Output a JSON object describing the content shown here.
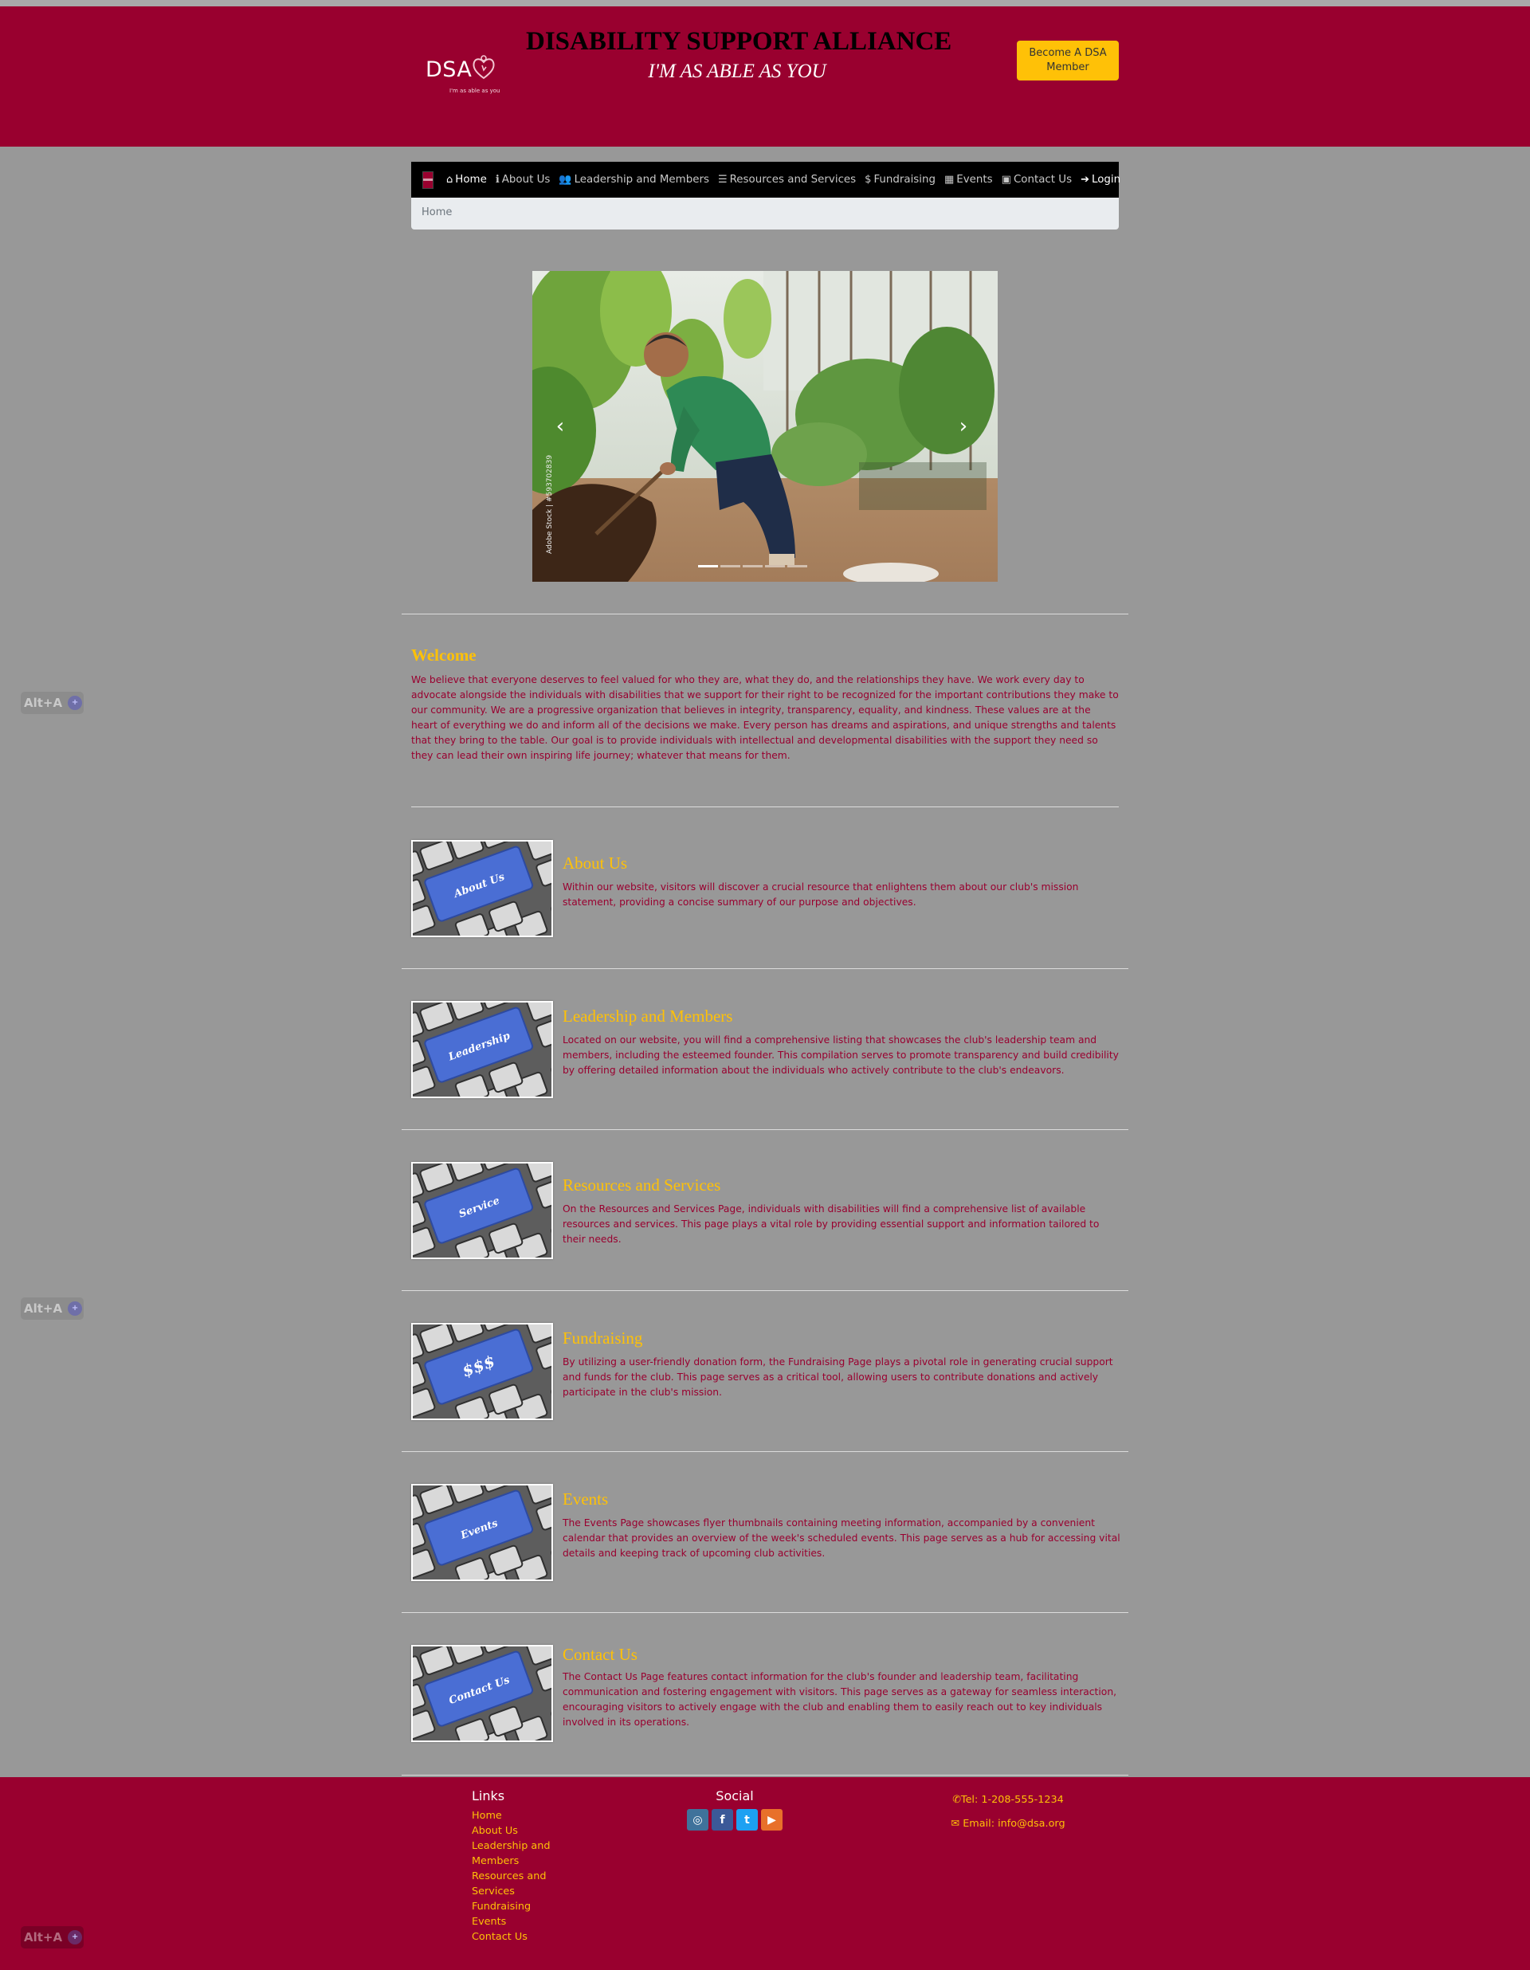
{
  "header": {
    "logo_text": "DSA",
    "logo_tagline": "I'm as able as you",
    "title": "DISABILITY SUPPORT ALLIANCE",
    "tagline": "I'M AS ABLE AS YOU",
    "member_button": "Become A DSA Member",
    "background_color": "#99002f",
    "accent_color": "#ffc107"
  },
  "nav": {
    "items": [
      {
        "label": "Home",
        "icon": "home-icon",
        "active": true
      },
      {
        "label": "About Us",
        "icon": "info-icon"
      },
      {
        "label": "Leadership and Members",
        "icon": "users-icon"
      },
      {
        "label": "Resources and Services",
        "icon": "list-icon"
      },
      {
        "label": "Fundraising",
        "icon": "dollar-icon"
      },
      {
        "label": "Events",
        "icon": "calendar-icon"
      },
      {
        "label": "Contact Us",
        "icon": "address-card-icon"
      },
      {
        "label": "Login",
        "icon": "sign-in-icon"
      }
    ],
    "breadcrumb": "Home"
  },
  "carousel": {
    "credit": "Adobe Stock | #593702839",
    "slide_count": 5,
    "active_slide": 1
  },
  "welcome": {
    "heading": "Welcome",
    "body": "We believe that everyone deserves to feel valued for who they are, what they do, and the relationships they have. We work every day to advocate alongside the individuals with disabilities that we support for their right to be recognized for the important contributions they make to our community. We are a progressive organization that believes in integrity, transparency, equality, and kindness. These values are at the heart of everything we do and inform all of the decisions we make. Every person has dreams and aspirations, and unique strengths and talents that they bring to the table. Our goal is to provide individuals with intellectual and developmental disabilities with the support they need so they can lead their own inspiring life journey; whatever that means for them."
  },
  "features": [
    {
      "title": "About Us",
      "key_label": "About Us",
      "text": "Within our website, visitors will discover a crucial resource that enlightens them about our club's mission statement, providing a concise summary of our purpose and objectives."
    },
    {
      "title": "Leadership and Members",
      "key_label": "Leadership",
      "text": "Located on our website, you will find a comprehensive listing that showcases the club's leadership team and members, including the esteemed founder. This compilation serves to promote transparency and build credibility by offering detailed information about the individuals who actively contribute to the club's endeavors."
    },
    {
      "title": "Resources and Services",
      "key_label": "Service",
      "text": "On the Resources and Services Page, individuals with disabilities will find a comprehensive list of available resources and services. This page plays a vital role by providing essential support and information tailored to their needs."
    },
    {
      "title": "Fundraising",
      "key_label": "$$$",
      "text": "By utilizing a user-friendly donation form, the Fundraising Page plays a pivotal role in generating crucial support and funds for the club. This page serves as a critical tool, allowing users to contribute donations and actively participate in the club's mission."
    },
    {
      "title": "Events",
      "key_label": "Events",
      "text": "The Events Page showcases flyer thumbnails containing meeting information, accompanied by a convenient calendar that provides an overview of the week's scheduled events. This page serves as a hub for accessing vital details and keeping track of upcoming club activities."
    },
    {
      "title": "Contact Us",
      "key_label": "Contact Us",
      "text": "The Contact Us Page features contact information for the club's founder and leadership team, facilitating communication and fostering engagement with visitors. This page serves as a gateway for seamless interaction, encouraging visitors to actively engage with the club and enabling them to easily reach out to key individuals involved in its operations."
    }
  ],
  "footer": {
    "links_heading": "Links",
    "links": [
      "Home",
      "About Us",
      "Leadership and Members",
      "Resources and Services",
      "Fundraising",
      "Events",
      "Contact Us"
    ],
    "social_heading": "Social",
    "social": [
      {
        "icon": "instagram-icon",
        "color": "#3f729b"
      },
      {
        "icon": "facebook-icon",
        "color": "#3b5998"
      },
      {
        "icon": "twitter-icon",
        "color": "#1da1f2"
      },
      {
        "icon": "youtube-icon",
        "color": "#e8702a"
      }
    ],
    "phone": "Tel: 1-208-555-1234",
    "email": "Email: info@dsa.org"
  },
  "overlay": {
    "shortcut_label": "Alt+A"
  }
}
